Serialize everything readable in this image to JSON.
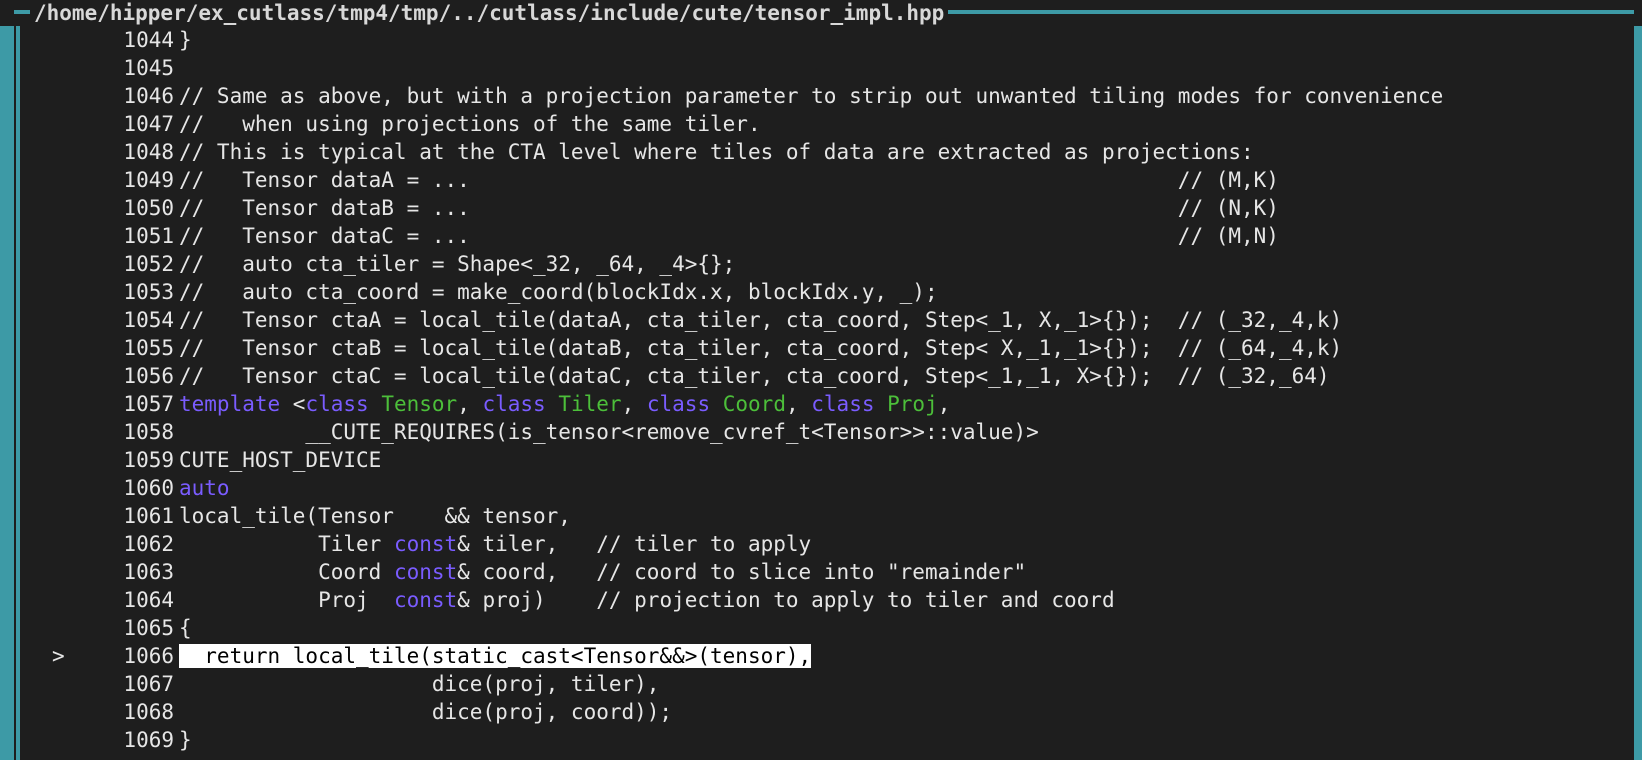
{
  "window": {
    "title": "/home/hipper/ex_cutlass/tmp4/tmp/../cutlass/include/cute/tensor_impl.hpp"
  },
  "colors": {
    "border": "#3d9aa6",
    "background": "#1e1e1e",
    "keyword": "#7a5cff",
    "type": "#4cbf3a",
    "text": "#e6e6e6",
    "highlight_bg": "#ffffff"
  },
  "current_line_marker": ">",
  "lines": [
    {
      "num": "1044",
      "segments": [
        [
          "t",
          "}"
        ]
      ]
    },
    {
      "num": "1045",
      "segments": []
    },
    {
      "num": "1046",
      "segments": [
        [
          "t",
          "// Same as above, but with a projection parameter to strip out unwanted tiling modes for convenience"
        ]
      ]
    },
    {
      "num": "1047",
      "segments": [
        [
          "t",
          "//   when using projections of the same tiler."
        ]
      ]
    },
    {
      "num": "1048",
      "segments": [
        [
          "t",
          "// This is typical at the CTA level where tiles of data are extracted as projections:"
        ]
      ]
    },
    {
      "num": "1049",
      "segments": [
        [
          "t",
          "//   Tensor dataA = ...                                                        // (M,K)"
        ]
      ]
    },
    {
      "num": "1050",
      "segments": [
        [
          "t",
          "//   Tensor dataB = ...                                                        // (N,K)"
        ]
      ]
    },
    {
      "num": "1051",
      "segments": [
        [
          "t",
          "//   Tensor dataC = ...                                                        // (M,N)"
        ]
      ]
    },
    {
      "num": "1052",
      "segments": [
        [
          "t",
          "//   auto cta_tiler = Shape<_32, _64, _4>{};"
        ]
      ]
    },
    {
      "num": "1053",
      "segments": [
        [
          "t",
          "//   auto cta_coord = make_coord(blockIdx.x, blockIdx.y, _);"
        ]
      ]
    },
    {
      "num": "1054",
      "segments": [
        [
          "t",
          "//   Tensor ctaA = local_tile(dataA, cta_tiler, cta_coord, Step<_1, X,_1>{});  // (_32,_4,k)"
        ]
      ]
    },
    {
      "num": "1055",
      "segments": [
        [
          "t",
          "//   Tensor ctaB = local_tile(dataB, cta_tiler, cta_coord, Step< X,_1,_1>{});  // (_64,_4,k)"
        ]
      ]
    },
    {
      "num": "1056",
      "segments": [
        [
          "t",
          "//   Tensor ctaC = local_tile(dataC, cta_tiler, cta_coord, Step<_1,_1, X>{});  // (_32,_64)"
        ]
      ]
    },
    {
      "num": "1057",
      "segments": [
        [
          "kw",
          "template"
        ],
        [
          "t",
          " <"
        ],
        [
          "kw",
          "class"
        ],
        [
          "t",
          " "
        ],
        [
          "ty",
          "Tensor"
        ],
        [
          "t",
          ", "
        ],
        [
          "kw",
          "class"
        ],
        [
          "t",
          " "
        ],
        [
          "ty",
          "Tiler"
        ],
        [
          "t",
          ", "
        ],
        [
          "kw",
          "class"
        ],
        [
          "t",
          " "
        ],
        [
          "ty",
          "Coord"
        ],
        [
          "t",
          ", "
        ],
        [
          "kw",
          "class"
        ],
        [
          "t",
          " "
        ],
        [
          "ty",
          "Proj"
        ],
        [
          "t",
          ","
        ]
      ]
    },
    {
      "num": "1058",
      "segments": [
        [
          "t",
          "          __CUTE_REQUIRES(is_tensor<remove_cvref_t<Tensor>>::value)>"
        ]
      ]
    },
    {
      "num": "1059",
      "segments": [
        [
          "t",
          "CUTE_HOST_DEVICE"
        ]
      ]
    },
    {
      "num": "1060",
      "segments": [
        [
          "kw",
          "auto"
        ]
      ]
    },
    {
      "num": "1061",
      "segments": [
        [
          "t",
          "local_tile(Tensor    && tensor,"
        ]
      ]
    },
    {
      "num": "1062",
      "segments": [
        [
          "t",
          "           Tiler "
        ],
        [
          "kw",
          "const"
        ],
        [
          "t",
          "& tiler,   // tiler to apply"
        ]
      ]
    },
    {
      "num": "1063",
      "segments": [
        [
          "t",
          "           Coord "
        ],
        [
          "kw",
          "const"
        ],
        [
          "t",
          "& coord,   // coord to slice into \"remainder\""
        ]
      ]
    },
    {
      "num": "1064",
      "segments": [
        [
          "t",
          "           Proj  "
        ],
        [
          "kw",
          "const"
        ],
        [
          "t",
          "& proj)    // projection to apply to tiler and coord"
        ]
      ]
    },
    {
      "num": "1065",
      "segments": [
        [
          "t",
          "{"
        ]
      ]
    },
    {
      "num": "1066",
      "current": true,
      "segments": [
        [
          "hl",
          "  return local_tile(static_cast<Tensor&&>(tensor),"
        ]
      ]
    },
    {
      "num": "1067",
      "segments": [
        [
          "t",
          "                    dice(proj, tiler),"
        ]
      ]
    },
    {
      "num": "1068",
      "segments": [
        [
          "t",
          "                    dice(proj, coord));"
        ]
      ]
    },
    {
      "num": "1069",
      "segments": [
        [
          "t",
          "}"
        ]
      ]
    }
  ]
}
